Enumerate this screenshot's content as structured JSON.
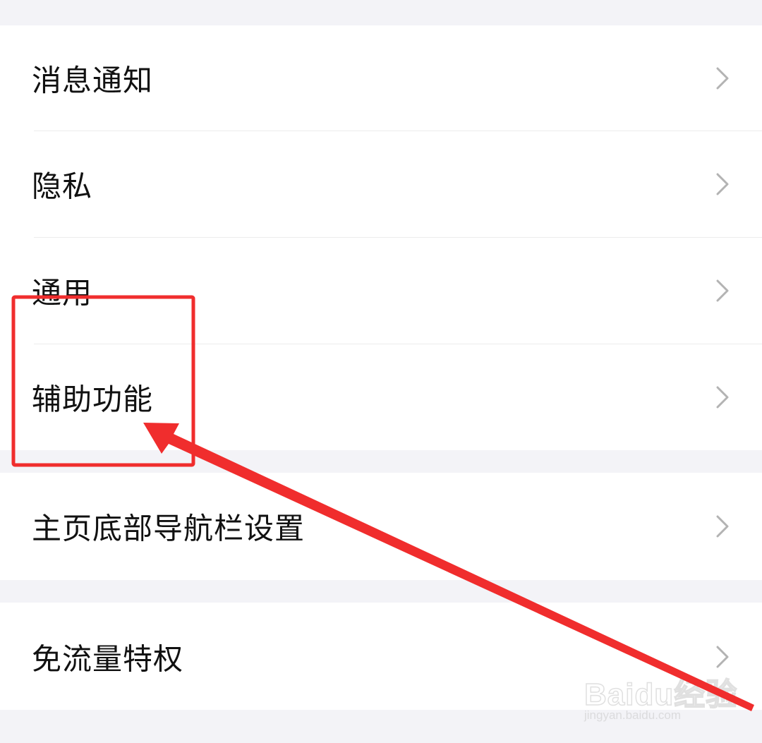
{
  "settings": {
    "group1": [
      {
        "label": "消息通知"
      },
      {
        "label": "隐私"
      },
      {
        "label": "通用"
      },
      {
        "label": "辅助功能"
      }
    ],
    "group2": [
      {
        "label": "主页底部导航栏设置"
      }
    ],
    "group3": [
      {
        "label": "免流量特权"
      }
    ]
  },
  "icons": {
    "row_arrow": "chevron-right-icon"
  },
  "annotation": {
    "color": "#f02d2d",
    "highlighted_item": "辅助功能"
  },
  "watermark": {
    "logo_text": "Baidu经验",
    "url_text": "jingyan.baidu.com"
  },
  "colors": {
    "background": "#f2f2f6",
    "row_background": "#ffffff",
    "text": "#111111",
    "chevron": "#b3b3b3"
  }
}
